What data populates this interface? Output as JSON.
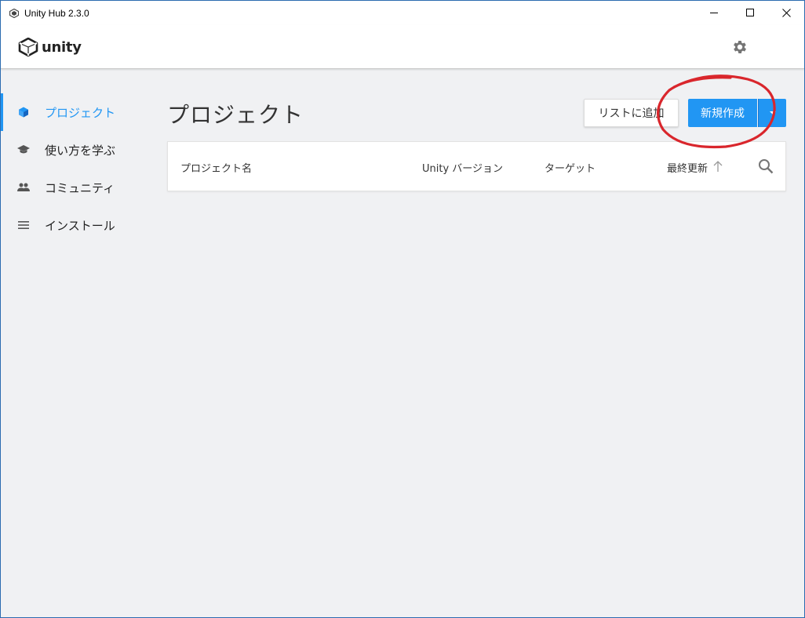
{
  "window": {
    "title": "Unity Hub 2.3.0"
  },
  "header": {
    "logo_text": "unity"
  },
  "sidebar": {
    "items": [
      {
        "label": "プロジェクト",
        "icon": "cube-icon",
        "active": true
      },
      {
        "label": "使い方を学ぶ",
        "icon": "graduation-cap-icon",
        "active": false
      },
      {
        "label": "コミュニティ",
        "icon": "people-icon",
        "active": false
      },
      {
        "label": "インストール",
        "icon": "list-icon",
        "active": false
      }
    ]
  },
  "main": {
    "title": "プロジェクト",
    "add_button": "リストに追加",
    "new_button": "新規作成",
    "columns": {
      "name": "プロジェクト名",
      "version": "Unity バージョン",
      "target": "ターゲット",
      "modified": "最終更新"
    }
  },
  "colors": {
    "accent": "#2196f3",
    "annotation": "#d9262c",
    "background": "#f0f1f3"
  }
}
